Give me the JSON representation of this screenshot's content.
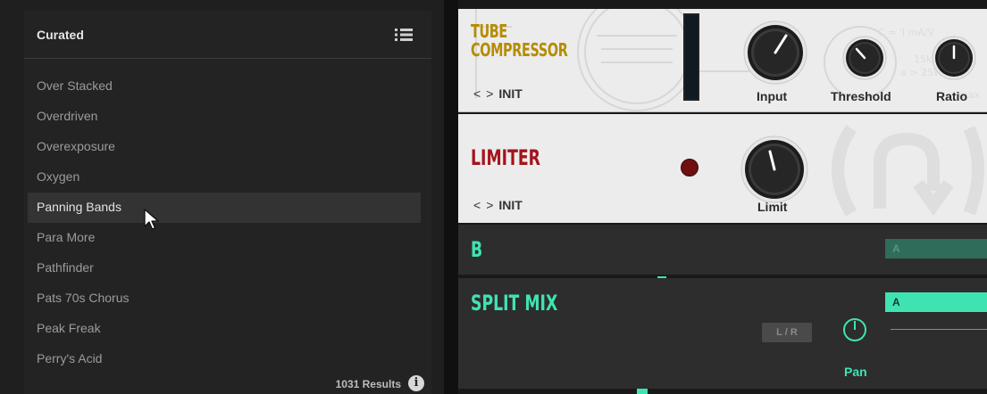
{
  "browser": {
    "title": "Curated",
    "list_view_icon": "list-icon",
    "presets": [
      {
        "label": "Over Stacked",
        "selected": false
      },
      {
        "label": "Overdriven",
        "selected": false
      },
      {
        "label": "Overexposure",
        "selected": false
      },
      {
        "label": "Oxygen",
        "selected": false
      },
      {
        "label": "Panning Bands",
        "selected": true
      },
      {
        "label": "Para More",
        "selected": false
      },
      {
        "label": "Pathfinder",
        "selected": false
      },
      {
        "label": "Pats 70s Chorus",
        "selected": false
      },
      {
        "label": "Peak Freak",
        "selected": false
      },
      {
        "label": "Perry's Acid",
        "selected": false
      }
    ],
    "results": "1031 Results",
    "info_icon": "i"
  },
  "tube_compressor": {
    "title_line1": "TUBE",
    "title_line2": "COMPRESSOR",
    "prev": "<",
    "next": ">",
    "preset": "INIT",
    "knobs": [
      {
        "label": "Input",
        "icon": "knob-icon"
      },
      {
        "label": "Threshold",
        "icon": "knob-icon"
      },
      {
        "label": "Ratio",
        "icon": "knob-icon"
      }
    ],
    "bg_text": [
      "C = 'I mA/V",
      "15k",
      "a > 25W",
      "max"
    ]
  },
  "limiter": {
    "title": "LIMITER",
    "prev": "<",
    "next": ">",
    "preset": "INIT",
    "knob_label": "Limit",
    "led_color": "#6e1010"
  },
  "b_module": {
    "title": "B",
    "bar_label": "A"
  },
  "split_mix": {
    "title": "SPLIT MIX",
    "bar_label": "A",
    "lr_button": "L / R",
    "pan_label": "Pan"
  },
  "colors": {
    "gold": "#b58c00",
    "red": "#a4141b",
    "green": "#3fe3b2",
    "panel": "#232323"
  }
}
